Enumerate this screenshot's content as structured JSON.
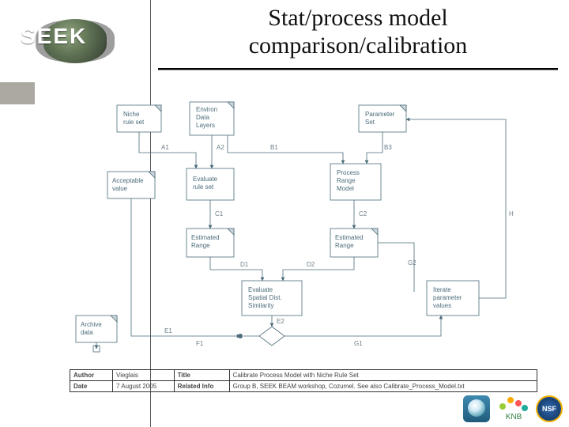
{
  "brand": {
    "name": "SEEK"
  },
  "title": {
    "line1": "Stat/process model",
    "line2": "comparison/calibration"
  },
  "nodes": {
    "niche": {
      "label1": "Niche",
      "label2": "rule set"
    },
    "environ": {
      "label1": "Environ",
      "label2": "Data",
      "label3": "Layers"
    },
    "param": {
      "label1": "Parameter",
      "label2": "Set"
    },
    "acceptable": {
      "label1": "Acceptable",
      "label2": "value"
    },
    "evalrule": {
      "label1": "Evaluate",
      "label2": "rule set"
    },
    "prm": {
      "label1": "Process",
      "label2": "Range",
      "label3": "Model"
    },
    "est1": {
      "label1": "Estimated",
      "label2": "Range"
    },
    "est2": {
      "label1": "Estimated",
      "label2": "Range"
    },
    "evalsim": {
      "label1": "Evaluate",
      "label2": "Spatial Dist.",
      "label3": "Similarity"
    },
    "iter": {
      "label1": "Iterate",
      "label2": "parameter",
      "label3": "values"
    },
    "archive": {
      "label1": "Archive",
      "label2": "data"
    }
  },
  "edges": {
    "A1": "A1",
    "A2": "A2",
    "B1": "B1",
    "B3": "B3",
    "C1": "C1",
    "C2": "C2",
    "D1": "D1",
    "D2": "D2",
    "E1": "E1",
    "E2": "E2",
    "F1": "F1",
    "G1": "G1",
    "G2": "G2",
    "H": "H"
  },
  "caption": {
    "author_k": "Author",
    "author_v": "Vieglais",
    "title_k": "Title",
    "title_v": "Calibrate Process Model with Niche Rule Set",
    "date_k": "Date",
    "date_v": "7 August 2005",
    "rel_k": "Related Info",
    "rel_v": "Group B, SEEK BEAM workshop, Cozumel.  See also Calibrate_Process_Model.txt"
  },
  "footer": {
    "knb": "KNB",
    "nsf": "NSF"
  }
}
